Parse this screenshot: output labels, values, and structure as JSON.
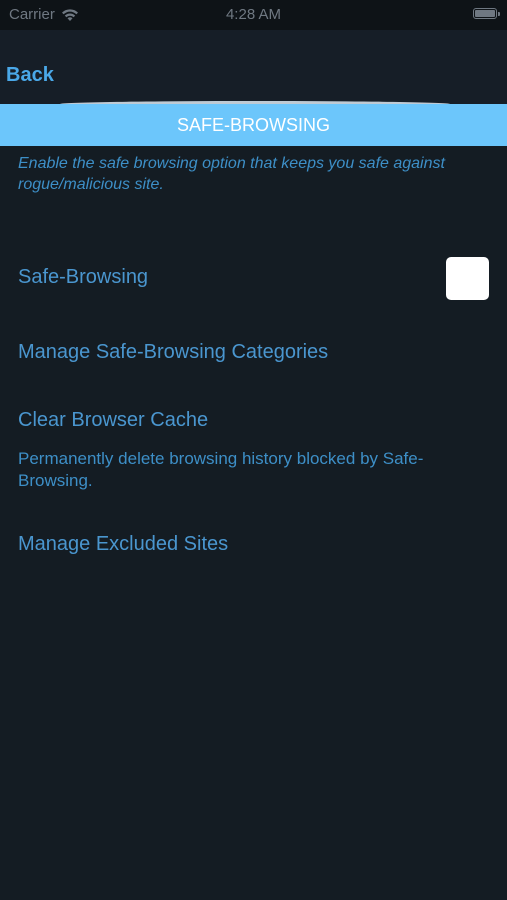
{
  "status_bar": {
    "carrier": "Carrier",
    "time": "4:28 AM"
  },
  "nav": {
    "back_label": "Back"
  },
  "section": {
    "title": "SAFE-BROWSING",
    "description": "Enable the safe browsing option that keeps you safe against rogue/malicious site."
  },
  "rows": {
    "safe_browsing": "Safe-Browsing",
    "manage_categories": "Manage Safe-Browsing Categories",
    "clear_cache": "Clear Browser Cache",
    "clear_cache_desc": "Permanently delete browsing history blocked by Safe-Browsing.",
    "excluded_sites": "Manage Excluded Sites"
  },
  "toggle": {
    "safe_browsing_checked": false
  },
  "colors": {
    "background": "#141c23",
    "accent": "#4aa8e8",
    "header": "#6cc6fb",
    "text": "#4a96cf"
  },
  "icons": [
    "wifi-icon",
    "battery-icon"
  ]
}
